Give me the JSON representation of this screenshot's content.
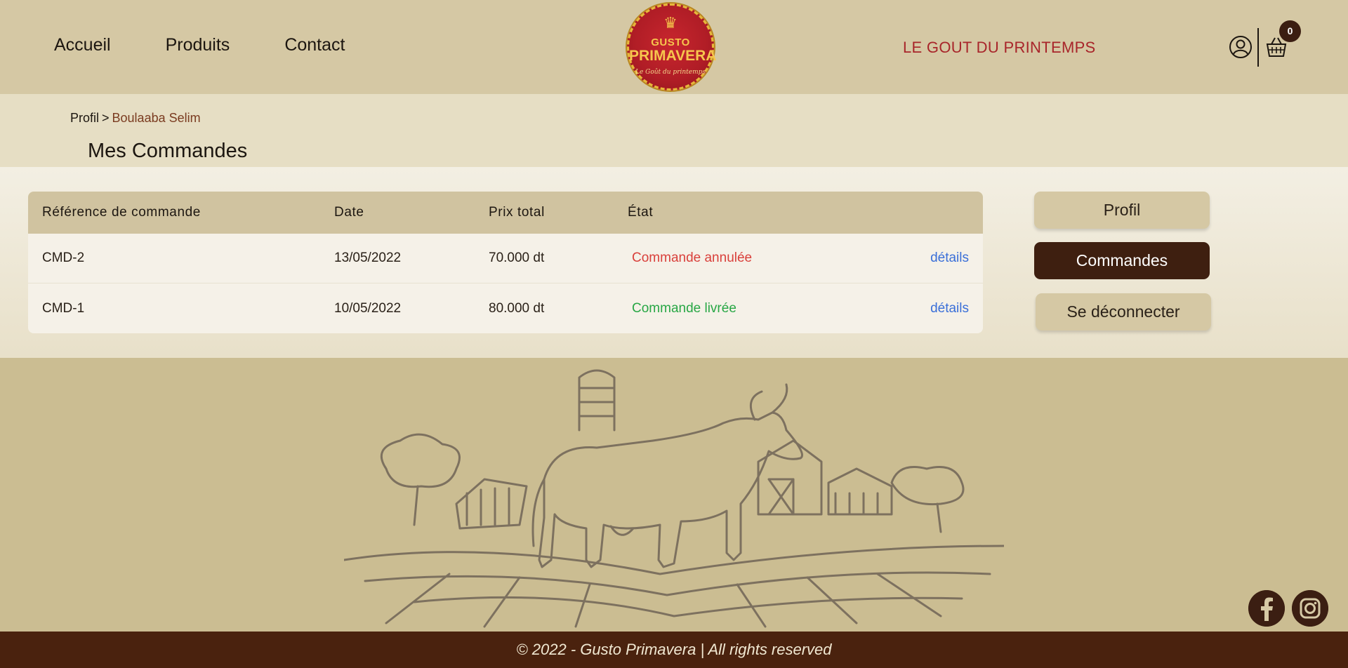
{
  "nav": {
    "items": [
      "Accueil",
      "Produits",
      "Contact"
    ]
  },
  "logo": {
    "line1": "GUSTO",
    "line2": "PRIMAVERA",
    "line3": "Le Goût du printemps"
  },
  "tagline": "LE GOUT DU PRINTEMPS",
  "cart": {
    "count": "0"
  },
  "breadcrumb": {
    "first": "Profil",
    "separator": ">",
    "current": "Boulaaba Selim"
  },
  "page_title": "Mes Commandes",
  "orders": {
    "headers": [
      "Référence de commande",
      "Date",
      "Prix total",
      "État"
    ],
    "rows": [
      {
        "ref": "CMD-2",
        "date": "13/05/2022",
        "total": "70.000 dt",
        "status": "Commande annulée",
        "link": "détails"
      },
      {
        "ref": "CMD-1",
        "date": "10/05/2022",
        "total": "80.000 dt",
        "status": "Commande livrée",
        "link": "détails"
      }
    ]
  },
  "sidebar": {
    "profil": "Profil",
    "commandes": "Commandes",
    "logout": "Se déconnecter"
  },
  "footer": {
    "text": "© 2022 - Gusto Primavera | All rights reserved"
  },
  "colors": {
    "accent": "#3e1f10",
    "tagline": "#a8252a",
    "cancel": "#d9403b",
    "delivered": "#28a745",
    "link": "#3a6fd8"
  },
  "icons": [
    "user-icon",
    "basket-icon",
    "facebook-icon",
    "instagram-icon"
  ]
}
